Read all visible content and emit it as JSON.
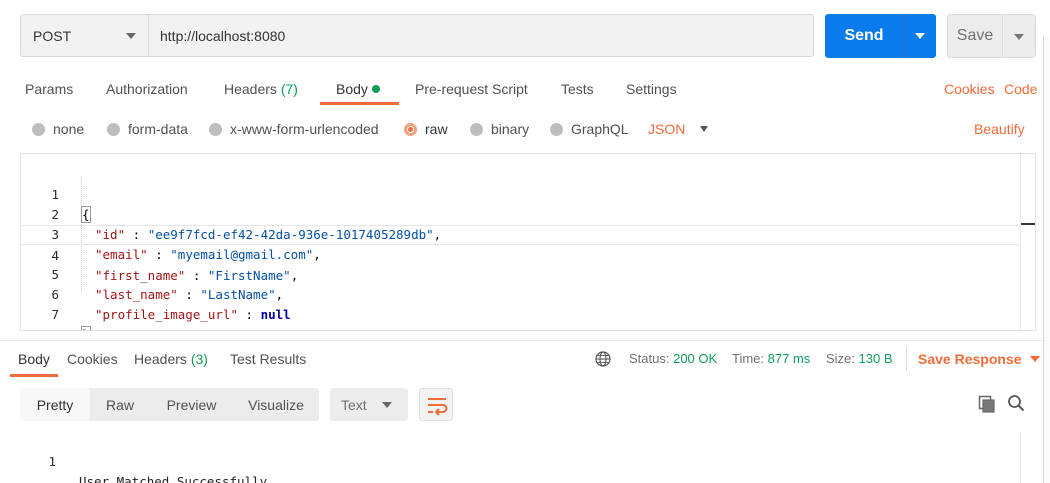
{
  "request": {
    "method": "POST",
    "url": "http://localhost:8080",
    "send_label": "Send",
    "save_label": "Save"
  },
  "request_tabs": {
    "params": "Params",
    "authorization": "Authorization",
    "headers": "Headers",
    "headers_count": "(7)",
    "body": "Body",
    "pre_request": "Pre-request Script",
    "tests": "Tests",
    "settings": "Settings",
    "cookies": "Cookies",
    "code": "Code"
  },
  "body_types": {
    "none": "none",
    "form_data": "form-data",
    "urlencoded": "x-www-form-urlencoded",
    "raw": "raw",
    "binary": "binary",
    "graphql": "GraphQL",
    "selected": "raw",
    "format": "JSON",
    "beautify": "Beautify"
  },
  "editor": {
    "line_numbers": [
      "1",
      "2",
      "3",
      "4",
      "5",
      "6",
      "7"
    ],
    "open_brace": "{",
    "close_brace": "}",
    "fields": [
      {
        "key": "\"id\"",
        "sep": " : ",
        "value": "\"ee9f7fcd-ef42-42da-936e-1017405289db\"",
        "tail": ","
      },
      {
        "key": "\"email\"",
        "sep": " : ",
        "value": "\"myemail@gmail.com\"",
        "tail": ","
      },
      {
        "key": "\"first_name\"",
        "sep": " : ",
        "value": "\"FirstName\"",
        "tail": ","
      },
      {
        "key": "\"last_name\"",
        "sep": " : ",
        "value": "\"LastName\"",
        "tail": ","
      },
      {
        "key": "\"profile_image_url\"",
        "sep": " : ",
        "value": "null",
        "tail": ""
      }
    ]
  },
  "response_tabs": {
    "body": "Body",
    "cookies": "Cookies",
    "headers": "Headers",
    "headers_count": "(3)",
    "test_results": "Test Results"
  },
  "response_meta": {
    "status_label": "Status:",
    "status_value": "200 OK",
    "time_label": "Time:",
    "time_value": "877 ms",
    "size_label": "Size:",
    "size_value": "130 B",
    "save_response": "Save Response"
  },
  "response_view": {
    "pretty": "Pretty",
    "raw": "Raw",
    "preview": "Preview",
    "visualize": "Visualize",
    "language": "Text",
    "active": "Pretty"
  },
  "response_body": {
    "line_number": "1",
    "text": "User Matched Successfully."
  },
  "colors": {
    "accent": "#f26b3a",
    "send": "#097bed",
    "success": "#0f9d58"
  }
}
